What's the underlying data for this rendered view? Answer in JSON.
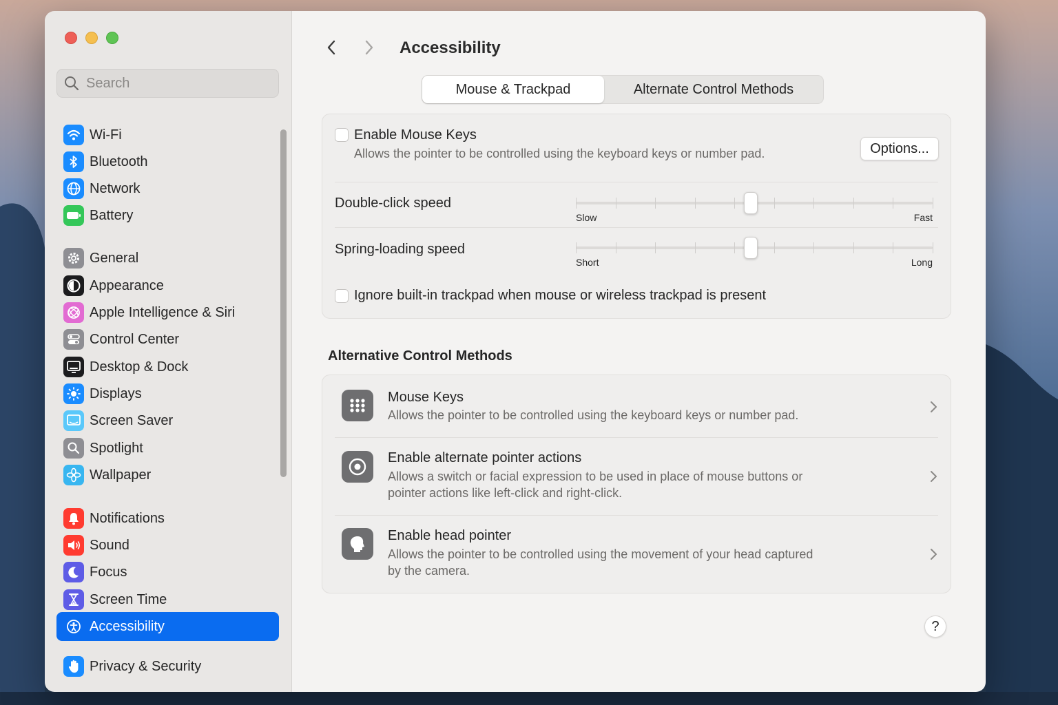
{
  "window": {
    "title": "Accessibility"
  },
  "sidebar": {
    "search_placeholder": "Search",
    "items": [
      {
        "label": "Wi-Fi",
        "icon": "wifi-icon",
        "color": "#1a8cff"
      },
      {
        "label": "Bluetooth",
        "icon": "bluetooth-icon",
        "color": "#1a8cff"
      },
      {
        "label": "Network",
        "icon": "globe-icon",
        "color": "#1a8cff"
      },
      {
        "label": "Battery",
        "icon": "battery-icon",
        "color": "#34c759"
      },
      {
        "label": "General",
        "icon": "gear-icon",
        "color": "#8e8e93"
      },
      {
        "label": "Appearance",
        "icon": "appearance-icon",
        "color": "#1c1c1e"
      },
      {
        "label": "Apple Intelligence & Siri",
        "icon": "siri-icon",
        "color": "#e26bd2"
      },
      {
        "label": "Control Center",
        "icon": "control-center-icon",
        "color": "#8e8e93"
      },
      {
        "label": "Desktop & Dock",
        "icon": "desktop-icon",
        "color": "#1c1c1e"
      },
      {
        "label": "Displays",
        "icon": "sun-icon",
        "color": "#1a8cff"
      },
      {
        "label": "Screen Saver",
        "icon": "screen-saver-icon",
        "color": "#5ac8fa"
      },
      {
        "label": "Spotlight",
        "icon": "magnifier-icon",
        "color": "#8e8e93"
      },
      {
        "label": "Wallpaper",
        "icon": "flower-icon",
        "color": "#38b6f0"
      },
      {
        "label": "Notifications",
        "icon": "bell-icon",
        "color": "#ff3b30"
      },
      {
        "label": "Sound",
        "icon": "speaker-icon",
        "color": "#ff3b30"
      },
      {
        "label": "Focus",
        "icon": "moon-icon",
        "color": "#5e5ce6"
      },
      {
        "label": "Screen Time",
        "icon": "hourglass-icon",
        "color": "#5e5ce6"
      },
      {
        "label": "Accessibility",
        "icon": "accessibility-icon",
        "color": "#1a8cff",
        "selected": true
      },
      {
        "label": "Privacy & Security",
        "icon": "hand-icon",
        "color": "#1a8cff"
      }
    ]
  },
  "tabs": [
    {
      "label": "Mouse & Trackpad",
      "selected": true
    },
    {
      "label": "Alternate Control Methods",
      "selected": false
    }
  ],
  "mouse_keys": {
    "label": "Enable Mouse Keys",
    "description": "Allows the pointer to be controlled using the keyboard keys or number pad.",
    "checked": false,
    "options_button": "Options..."
  },
  "double_click": {
    "label": "Double-click speed",
    "min_label": "Slow",
    "max_label": "Fast",
    "value_fraction": 0.49
  },
  "spring_loading": {
    "label": "Spring-loading speed",
    "min_label": "Short",
    "max_label": "Long",
    "value_fraction": 0.49
  },
  "ignore_trackpad": {
    "label": "Ignore built-in trackpad when mouse or wireless trackpad is present",
    "checked": false
  },
  "alt_section": {
    "title": "Alternative Control Methods",
    "rows": [
      {
        "title": "Mouse Keys",
        "description": "Allows the pointer to be controlled using the keyboard keys or number pad.",
        "icon": "keypad-icon"
      },
      {
        "title": "Enable alternate pointer actions",
        "description": "Allows a switch or facial expression to be used in place of mouse buttons or pointer actions like left-click and right-click.",
        "icon": "pointer-target-icon"
      },
      {
        "title": "Enable head pointer",
        "description": "Allows the pointer to be controlled using the movement of your head captured by the camera.",
        "icon": "head-icon"
      }
    ]
  },
  "help_label": "?",
  "colors": {
    "accent": "#0a6cf0"
  }
}
